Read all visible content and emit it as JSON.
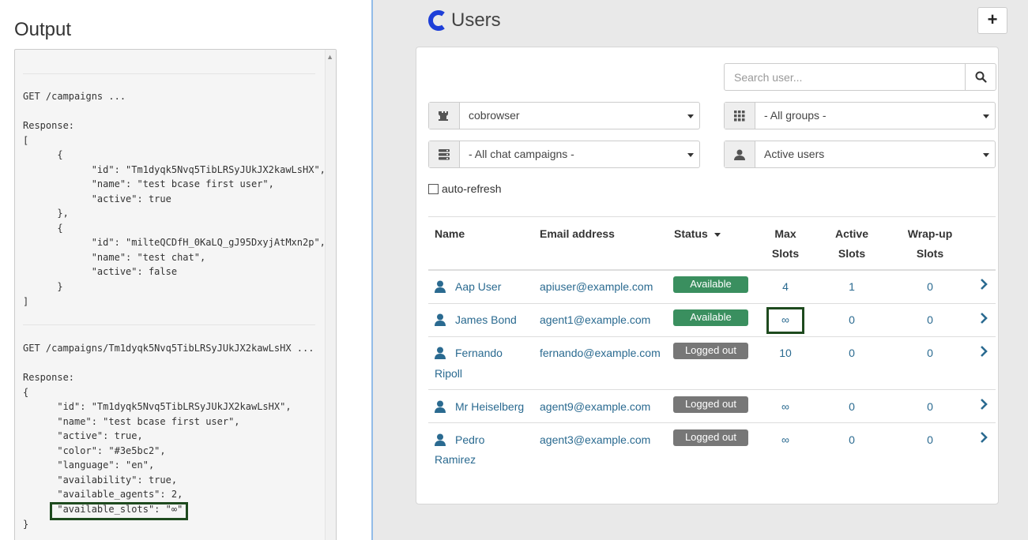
{
  "output": {
    "title": "Output",
    "lines": [
      "GET /campaigns ...",
      "Response:",
      "[",
      "      {",
      "            \"id\": \"Tm1dyqk5Nvq5TibLRSyJUkJX2kawLsHX\",",
      "            \"name\": \"test bcase first user\",",
      "            \"active\": true",
      "      },",
      "      {",
      "            \"id\": \"milteQCDfH_0KaLQ_gJ95DxyjAtMxn2p\",",
      "            \"name\": \"test chat\",",
      "            \"active\": false",
      "      }",
      "]",
      "GET /campaigns/Tm1dyqk5Nvq5TibLRSyJUkJX2kawLsHX ...",
      "Response:",
      "{",
      "      \"id\": \"Tm1dyqk5Nvq5TibLRSyJUkJX2kawLsHX\",",
      "      \"name\": \"test bcase first user\",",
      "      \"active\": true,",
      "      \"color\": \"#3e5bc2\",",
      "      \"language\": \"en\",",
      "      \"availability\": true,",
      "      \"available_agents\": 2,",
      "      \"available_slots\": \"∞\"",
      "}"
    ]
  },
  "app": {
    "title": "Users",
    "add_label": "+",
    "brand_color": "#1e3fd8",
    "search_placeholder": "Search user...",
    "filters": {
      "campaign": "cobrowser",
      "groups": "- All groups -",
      "chat_campaigns": "- All chat campaigns -",
      "user_state": "Active users"
    },
    "auto_refresh_label": "auto-refresh",
    "columns": {
      "name": "Name",
      "email": "Email address",
      "status": "Status",
      "max_slots_1": "Max",
      "max_slots_2": "Slots",
      "active_slots_1": "Active",
      "active_slots_2": "Slots",
      "wrapup_slots_1": "Wrap-up",
      "wrapup_slots_2": "Slots"
    },
    "users": [
      {
        "name_1": "Aap User",
        "name_2": "",
        "email": "apiuser@example.com",
        "status": "Available",
        "max": "4",
        "active": "1",
        "wrapup": "0"
      },
      {
        "name_1": "James Bond",
        "name_2": "",
        "email": "agent1@example.com",
        "status": "Available",
        "max": "∞",
        "active": "0",
        "wrapup": "0"
      },
      {
        "name_1": "Fernando",
        "name_2": "Ripoll",
        "email": "fernando@example.com",
        "status": "Logged out",
        "max": "10",
        "active": "0",
        "wrapup": "0"
      },
      {
        "name_1": "Mr Heiselberg",
        "name_2": "",
        "email": "agent9@example.com",
        "status": "Logged out",
        "max": "∞",
        "active": "0",
        "wrapup": "0"
      },
      {
        "name_1": "Pedro",
        "name_2": "Ramirez",
        "email": "agent3@example.com",
        "status": "Logged out",
        "max": "∞",
        "active": "0",
        "wrapup": "0"
      }
    ]
  }
}
